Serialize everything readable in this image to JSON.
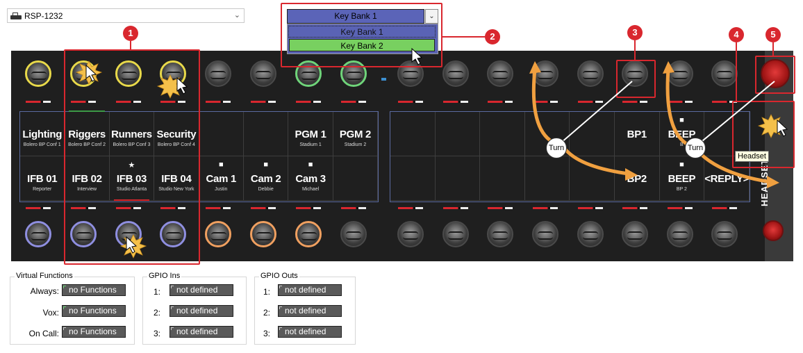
{
  "device_select": {
    "value": "RSP-1232"
  },
  "keybank": {
    "selected": "Key Bank 1",
    "options": [
      "Key Bank 1",
      "Key Bank 2"
    ]
  },
  "annotations": {
    "n1": "1",
    "n2": "2",
    "n3": "3",
    "n4": "4",
    "n5": "5",
    "turn": "Turn",
    "tooltip": "Headset"
  },
  "left_grid": {
    "top_row": [
      {
        "label": "Lighting",
        "sub": "Bolero BP Conf 1"
      },
      {
        "label": "Riggers",
        "sub": "Bolero BP Conf 2"
      },
      {
        "label": "Runners",
        "sub": "Bolero BP Conf 3"
      },
      {
        "label": "Security",
        "sub": "Bolero BP Conf 4"
      },
      {
        "label": "",
        "sub": ""
      },
      {
        "label": "",
        "sub": ""
      },
      {
        "label": "PGM 1",
        "sub": "Stadium 1"
      },
      {
        "label": "PGM 2",
        "sub": "Stadium 2"
      }
    ],
    "bottom_row": [
      {
        "label": "IFB 01",
        "sub": "Reporter",
        "icon": ""
      },
      {
        "label": "IFB 02",
        "sub": "Interview",
        "icon": ""
      },
      {
        "label": "IFB 03",
        "sub": "Studio Atlanta",
        "icon": "★"
      },
      {
        "label": "IFB 04",
        "sub": "Studio New York",
        "icon": ""
      },
      {
        "label": "Cam 1",
        "sub": "Justin",
        "icon": "■"
      },
      {
        "label": "Cam 2",
        "sub": "Debbie",
        "icon": "■"
      },
      {
        "label": "Cam 3",
        "sub": "Michael",
        "icon": "■"
      },
      {
        "label": "",
        "sub": "",
        "icon": ""
      }
    ]
  },
  "right_grid": {
    "top_row": [
      {
        "label": ""
      },
      {
        "label": ""
      },
      {
        "label": ""
      },
      {
        "label": ""
      },
      {
        "label": ""
      },
      {
        "label": "BP1",
        "sub": ""
      },
      {
        "label": "BEEP",
        "sub": "B",
        "icon": "■"
      },
      {
        "label": "",
        "sub": ""
      }
    ],
    "bottom_row": [
      {
        "label": ""
      },
      {
        "label": ""
      },
      {
        "label": ""
      },
      {
        "label": ""
      },
      {
        "label": ""
      },
      {
        "label": "BP2",
        "sub": ""
      },
      {
        "label": "BEEP",
        "sub": "BP 2",
        "icon": "■"
      },
      {
        "label": "<REPLY>",
        "sub": ""
      }
    ]
  },
  "rail_label": "HEADSET",
  "virtual_functions": {
    "title": "Virtual Functions",
    "rows": [
      {
        "label": "Always:",
        "value": "no Functions"
      },
      {
        "label": "Vox:",
        "value": "no Functions"
      },
      {
        "label": "On Call:",
        "value": "no Functions"
      }
    ]
  },
  "gpio_ins": {
    "title": "GPIO Ins",
    "rows": [
      {
        "label": "1:",
        "value": "not defined"
      },
      {
        "label": "2:",
        "value": "not defined"
      },
      {
        "label": "3:",
        "value": "not defined"
      }
    ]
  },
  "gpio_outs": {
    "title": "GPIO Outs",
    "rows": [
      {
        "label": "1:",
        "value": "not defined"
      },
      {
        "label": "2:",
        "value": "not defined"
      },
      {
        "label": "3:",
        "value": "not defined"
      }
    ]
  },
  "colors": {
    "accent_red": "#d9272e",
    "keybank_blue": "#5b64b8",
    "keybank_green": "#78d060",
    "arrow_orange": "#f0a040"
  }
}
